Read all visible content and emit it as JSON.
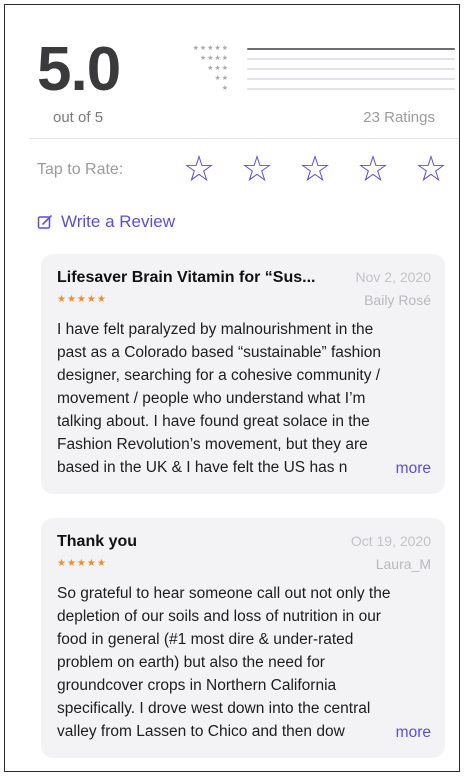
{
  "summary": {
    "score": "5.0",
    "out_of": "out of 5",
    "ratings_count": "23 Ratings",
    "distribution": [
      {
        "stars": "★★★★★",
        "fraction": 1.0
      },
      {
        "stars": "★★★★",
        "fraction": 0.0
      },
      {
        "stars": "★★★",
        "fraction": 0.0
      },
      {
        "stars": "★★",
        "fraction": 0.0
      },
      {
        "stars": "★",
        "fraction": 0.0
      }
    ]
  },
  "tap_to_rate": {
    "label": "Tap to Rate:",
    "stars": [
      "☆",
      "☆",
      "☆",
      "☆",
      "☆"
    ]
  },
  "write_review": {
    "label": "Write a Review",
    "icon": "compose-icon"
  },
  "reviews": [
    {
      "title": "Lifesaver Brain Vitamin for “Sus...",
      "date": "Nov 2, 2020",
      "stars": "★★★★★",
      "author": "Baily Rosé",
      "body_lines": [
        "I have felt paralyzed by malnourishment in the",
        "past as a Colorado based “sustainable” fashion",
        "designer, searching for a cohesive community /",
        "movement / people who understand what I’m",
        "talking about. I have found great solace in the",
        "Fashion Revolution’s movement, but they are",
        "based in the UK & I have felt the US has n"
      ],
      "more": "more"
    },
    {
      "title": "Thank you",
      "date": "Oct 19, 2020",
      "stars": "★★★★★",
      "author": "Laura_M",
      "body_lines": [
        "So grateful to hear someone call out not only the",
        "depletion of our soils and loss of nutrition in our",
        "food in general (#1 most dire & under-rated",
        "problem on earth) but also the need for",
        "groundcover crops in Northern California",
        "specifically. I drove west down into the central",
        "valley from Lassen to Chico and then dow"
      ],
      "more": "more"
    }
  ],
  "colors": {
    "accent": "#5b4fd0",
    "star_fill": "#f08c2a",
    "card_bg": "#f3f3f5"
  }
}
